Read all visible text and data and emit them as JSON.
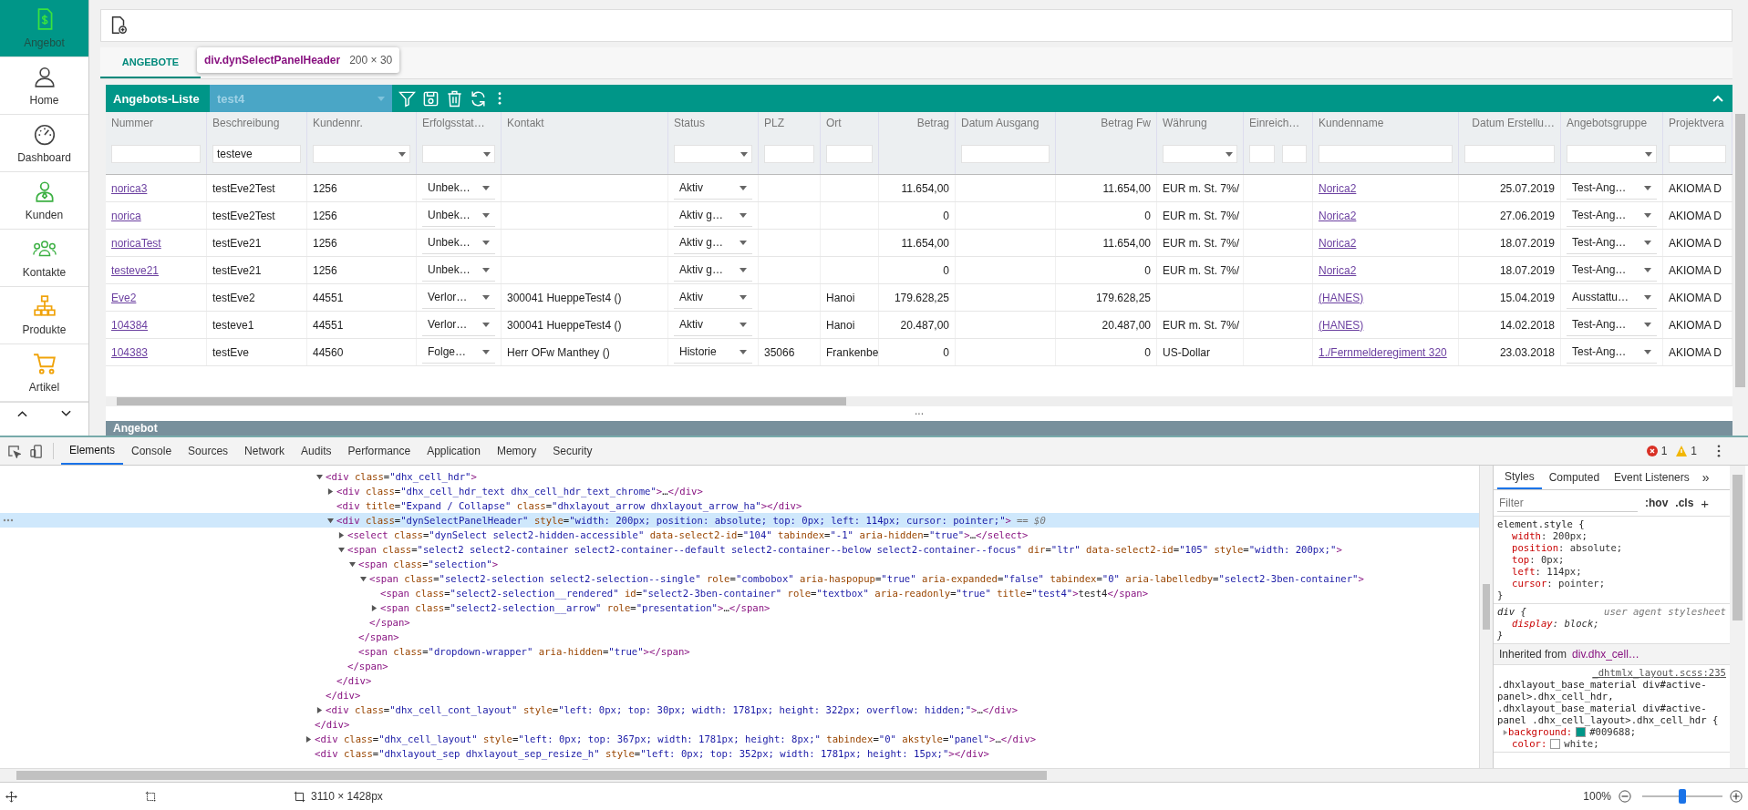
{
  "sidebar": {
    "items": [
      {
        "label": "Angebot",
        "selected": true
      },
      {
        "label": "Home",
        "selected": false
      },
      {
        "label": "Dashboard",
        "selected": false
      },
      {
        "label": "Kunden",
        "selected": false
      },
      {
        "label": "Kontakte",
        "selected": false
      },
      {
        "label": "Produkte",
        "selected": false
      },
      {
        "label": "Artikel",
        "selected": false
      }
    ]
  },
  "tabs": [
    {
      "label": "ANGEBOTE",
      "selected": true
    }
  ],
  "tooltip": {
    "element": "div.dynSelectPanelHeader",
    "size": "200 × 30"
  },
  "panel": {
    "title": "Angebots-Liste",
    "select_value": "test4",
    "bottom_title": "Angebot",
    "more": "..."
  },
  "table": {
    "columns": [
      {
        "label": "Nummer",
        "kind": "link",
        "filter": {
          "kind": "text"
        }
      },
      {
        "label": "Beschreibung",
        "kind": "text",
        "filter": {
          "kind": "text",
          "value": "testeve"
        }
      },
      {
        "label": "Kundennr.",
        "kind": "text",
        "filter": {
          "kind": "select"
        }
      },
      {
        "label": "Erfolgsstat…",
        "kind": "select",
        "filter": {
          "kind": "select"
        }
      },
      {
        "label": "Kontakt",
        "kind": "text"
      },
      {
        "label": "Status",
        "kind": "select",
        "filter": {
          "kind": "select"
        }
      },
      {
        "label": "PLZ",
        "kind": "text",
        "filter": {
          "kind": "text"
        }
      },
      {
        "label": "Ort",
        "kind": "text",
        "filter": {
          "kind": "text"
        }
      },
      {
        "label": "Betrag",
        "kind": "num"
      },
      {
        "label": "Datum Ausgang",
        "kind": "text",
        "filter": {
          "kind": "text"
        }
      },
      {
        "label": "Betrag Fw",
        "kind": "num"
      },
      {
        "label": "Währung",
        "kind": "text",
        "filter": {
          "kind": "select"
        }
      },
      {
        "label": "Einreich…",
        "kind": "text",
        "filter": {
          "kind": "pair"
        }
      },
      {
        "label": "Kundenname",
        "kind": "link",
        "filter": {
          "kind": "text"
        }
      },
      {
        "label": "Datum Erstellu…",
        "kind": "num",
        "filter": {
          "kind": "text"
        }
      },
      {
        "label": "Angebotsgruppe",
        "kind": "select",
        "filter": {
          "kind": "select"
        }
      },
      {
        "label": "Projektvera",
        "kind": "text",
        "filter": {
          "kind": "text"
        }
      }
    ],
    "rows": [
      [
        "norica3",
        "testEve2Test",
        "1256",
        "Unbek…",
        null,
        "Aktiv",
        null,
        null,
        "11.654,00",
        null,
        "11.654,00",
        "EUR m. St. 7%/",
        null,
        "Norica2",
        "25.07.2019",
        "Test-Ang…",
        "AKIOMA D"
      ],
      [
        "norica",
        "testEve2Test",
        "1256",
        "Unbek…",
        null,
        "Aktiv g…",
        null,
        null,
        "0",
        null,
        "0",
        "EUR m. St. 7%/",
        null,
        "Norica2",
        "27.06.2019",
        "Test-Ang…",
        "AKIOMA D"
      ],
      [
        "noricaTest",
        "testEve21",
        "1256",
        "Unbek…",
        null,
        "Aktiv g…",
        null,
        null,
        "11.654,00",
        null,
        "11.654,00",
        "EUR m. St. 7%/",
        null,
        "Norica2",
        "18.07.2019",
        "Test-Ang…",
        "AKIOMA D"
      ],
      [
        "testeve21",
        "testEve21",
        "1256",
        "Unbek…",
        null,
        "Aktiv g…",
        null,
        null,
        "0",
        null,
        "0",
        "EUR m. St. 7%/",
        null,
        "Norica2",
        "18.07.2019",
        "Test-Ang…",
        "AKIOMA D"
      ],
      [
        "Eve2",
        "testEve2",
        "44551",
        "Verlor…",
        "300041 HueppeTest4 ()",
        "Aktiv",
        null,
        "Hanoi",
        "179.628,25",
        null,
        "179.628,25",
        null,
        null,
        "(HANES)",
        "15.04.2019",
        "Ausstattu…",
        "AKIOMA D"
      ],
      [
        "104384",
        "testeve1",
        "44551",
        "Verlor…",
        "300041 HueppeTest4 ()",
        "Aktiv",
        null,
        "Hanoi",
        "20.487,00",
        null,
        "20.487,00",
        "EUR m. St. 7%/",
        null,
        "(HANES)",
        "14.02.2018",
        "Test-Ang…",
        "AKIOMA D"
      ],
      [
        "104383",
        "testEve",
        "44560",
        "Folge…",
        "Herr OFw Manthey ()",
        "Historie",
        "35066",
        "Frankenbe",
        "0",
        null,
        "0",
        "US-Dollar",
        null,
        "1./Fernmelderegiment 320",
        "23.03.2018",
        "Test-Ang…",
        "AKIOMA D"
      ]
    ]
  },
  "devtools": {
    "tabs": [
      {
        "label": "Elements",
        "selected": true
      },
      {
        "label": "Console",
        "selected": false
      },
      {
        "label": "Sources",
        "selected": false
      },
      {
        "label": "Network",
        "selected": false
      },
      {
        "label": "Audits",
        "selected": false
      },
      {
        "label": "Performance",
        "selected": false
      },
      {
        "label": "Application",
        "selected": false
      },
      {
        "label": "Memory",
        "selected": false
      },
      {
        "label": "Security",
        "selected": false
      }
    ],
    "errors": "1",
    "warnings": "1",
    "dom_tree": [
      {
        "children": [
          {
            "text": "<div class=\"dhx_cell_hdr\">",
            "expanded": true,
            "selected": false,
            "children": [
              {
                "text": "<div class=\"dhx_cell_hdr_text dhx_cell_hdr_text_chrome\">…</div>",
                "expanded": false,
                "selected": false
              },
              {
                "text": "<div title=\"Expand / Collapse\" class=\"dhxlayout_arrow dhxlayout_arrow_ha\"></div>",
                "selected": false
              },
              {
                "text": "<div class=\"dynSelectPanelHeader\" style=\"width: 200px; position: absolute; top: 0px; left: 114px; cursor: pointer;\">",
                "marker": "== $0",
                "expanded": true,
                "selected": true,
                "children": [
                  {
                    "text": "<select class=\"dynSelect select2-hidden-accessible\" data-select2-id=\"104\" tabindex=\"-1\" aria-hidden=\"true\">…</select>",
                    "expanded": false,
                    "selected": false
                  },
                  {
                    "text": "<span class=\"select2 select2-container select2-container--default select2-container--below select2-container--focus\" dir=\"ltr\" data-select2-id=\"105\" style=\"width: 200px;\">",
                    "expanded": true,
                    "selected": false,
                    "children": [
                      {
                        "text": "<span class=\"selection\">",
                        "expanded": true,
                        "selected": false,
                        "children": [
                          {
                            "text": "<span class=\"select2-selection select2-selection--single\" role=\"combobox\" aria-haspopup=\"true\" aria-expanded=\"false\" tabindex=\"0\" aria-labelledby=\"select2-3ben-container\">",
                            "expanded": true,
                            "selected": false,
                            "children": [
                              {
                                "text": "<span class=\"select2-selection__rendered\" id=\"select2-3ben-container\" role=\"textbox\" aria-readonly=\"true\" title=\"test4\">test4</span>",
                                "selected": false
                              },
                              {
                                "text": "<span class=\"select2-selection__arrow\" role=\"presentation\">…</span>",
                                "expanded": false,
                                "selected": false
                              }
                            ],
                            "closing": "</span>"
                          }
                        ],
                        "closing": "</span>"
                      },
                      {
                        "text": "<span class=\"dropdown-wrapper\" aria-hidden=\"true\"></span>",
                        "selected": false
                      }
                    ],
                    "closing": "</span>"
                  }
                ],
                "closing": "</div>"
              }
            ],
            "closing": "</div>"
          },
          {
            "text": "<div class=\"dhx_cell_cont_layout\" style=\"left: 0px; top: 30px; width: 1781px; height: 322px; overflow: hidden;\">…</div>",
            "expanded": false,
            "selected": false
          }
        ],
        "closing": "</div>"
      },
      {
        "text": "<div class=\"dhx_cell_layout\" style=\"left: 0px; top: 367px; width: 1781px; height: 8px;\" tabindex=\"0\" akstyle=\"panel\">…</div>",
        "expanded": false,
        "selected": false
      },
      {
        "text": "<div class=\"dhxlayout_sep dhxlayout_sep_resize_h\" style=\"left: 0px; top: 352px; width: 1781px; height: 15px;\"></div>",
        "selected": false
      }
    ],
    "styles": {
      "tabs": [
        {
          "label": "Styles",
          "selected": true
        },
        {
          "label": "Computed",
          "selected": false
        },
        {
          "label": "Event Listeners",
          "selected": false
        }
      ],
      "more": "»",
      "filter_placeholder": "Filter",
      "hov": ":hov",
      "cls": ".cls",
      "add": "+",
      "rules": [
        {
          "selector": "element.style {",
          "declarations": [
            {
              "text": "width: 200px;"
            },
            {
              "text": "position: absolute;"
            },
            {
              "text": "top: 0px;"
            },
            {
              "text": "left: 114px;"
            },
            {
              "text": "cursor: pointer;"
            }
          ],
          "closing": "}"
        },
        {
          "kind": "agent",
          "selector": "div {",
          "source": "user agent stylesheet",
          "declarations": [
            {
              "text": "display: block;"
            }
          ],
          "closing": "}"
        }
      ],
      "inherited_label": "Inherited from",
      "inherited_element": "div.dhx_cell…",
      "inherited_rules": [
        {
          "selector": ".dhxlayout_base_material div#active-panel>.dhx_cell_hdr, .dhxlayout_base_material div#active-panel .dhx_cell_layout>.dhx_cell_hdr {",
          "source": "_dhtmlx_layout.scss:235",
          "declarations": [
            {
              "text": "background: #009688;",
              "expandable": true,
              "swatch": true
            },
            {
              "text": "color: white;",
              "swatch": true
            }
          ]
        }
      ]
    }
  },
  "status_bar": {
    "dimensions": "3110 × 1428px",
    "zoom": "100%",
    "zoom_slider": {
      "level": 0.5
    }
  }
}
